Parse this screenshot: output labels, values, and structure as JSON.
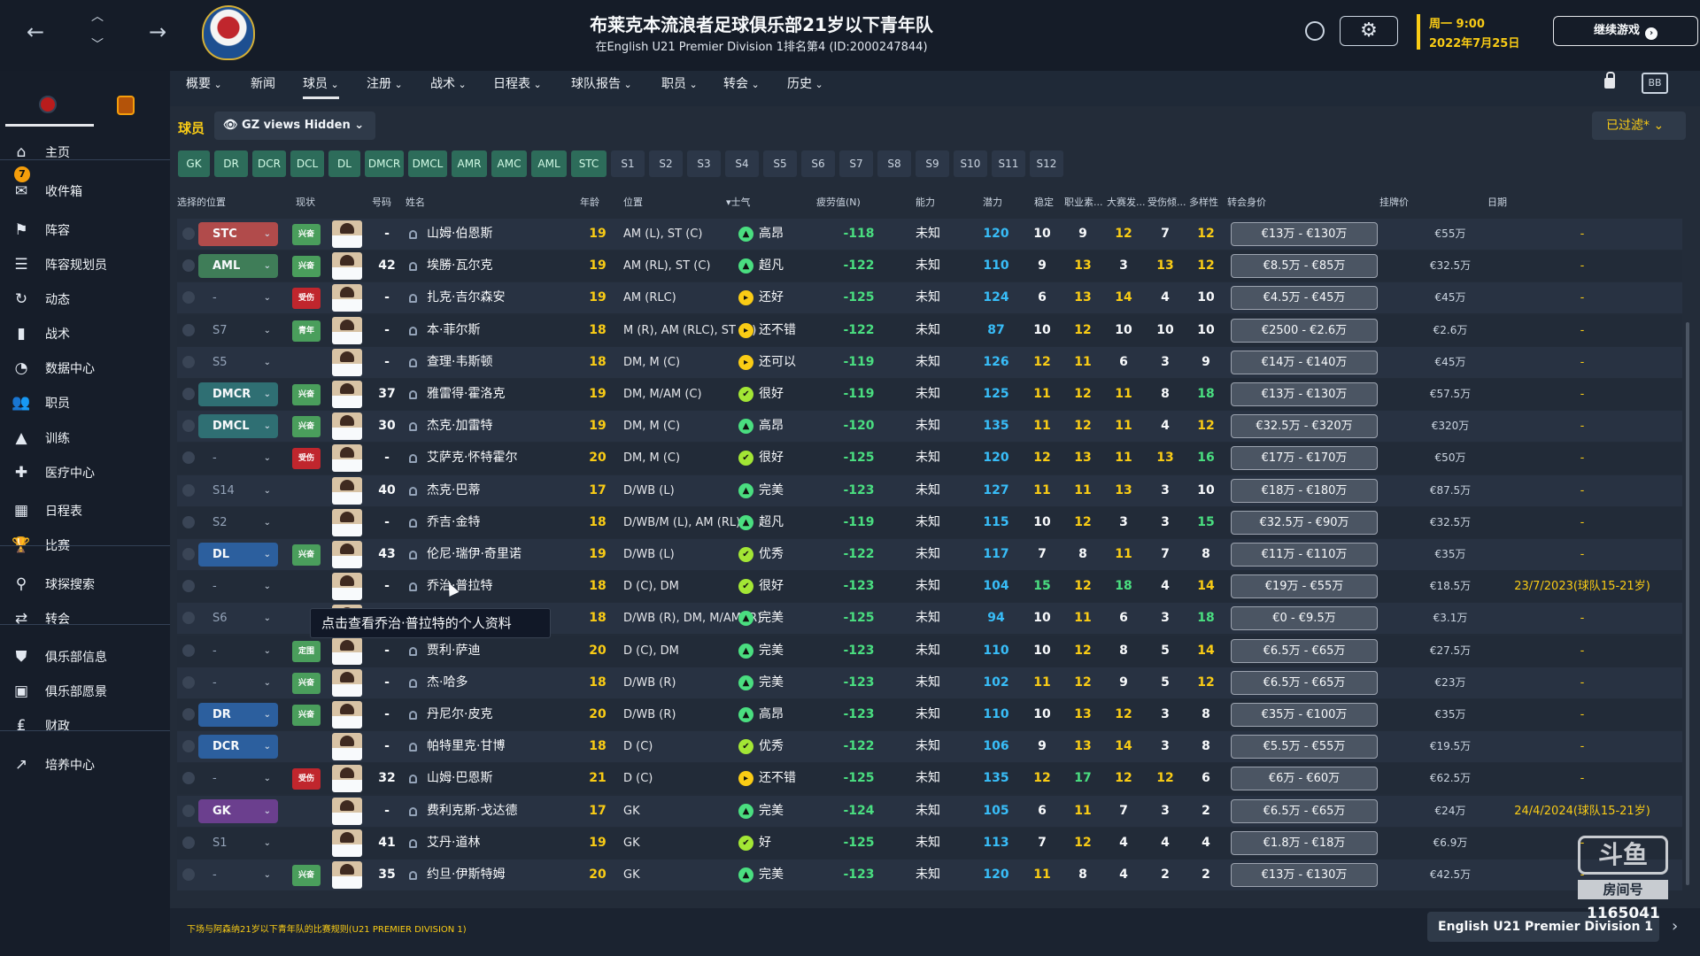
{
  "header": {
    "club_title": "布莱克本流浪者足球俱乐部21岁以下青年队",
    "club_subtitle": "在English U21 Premier Division 1排名第4 (ID:2000247844)",
    "date_day": "周一 9:00",
    "date_date": "2022年7月25日",
    "continue_label": "继续游戏",
    "nav_icons": {
      "back": "arrow-left-icon",
      "up": "chevron-up-icon",
      "down": "chevron-down-icon",
      "forward": "arrow-right-icon"
    },
    "settings_glyph": "⚙",
    "layout_glyph": "BB"
  },
  "nav": {
    "items": [
      {
        "label": "概要",
        "caret": true
      },
      {
        "label": "新闻",
        "caret": false
      },
      {
        "label": "球员",
        "caret": true,
        "active": true
      },
      {
        "label": "注册",
        "caret": true
      },
      {
        "label": "战术",
        "caret": true
      },
      {
        "label": "日程表",
        "caret": true
      },
      {
        "label": "球队报告",
        "caret": true
      },
      {
        "label": "职员",
        "caret": true
      },
      {
        "label": "转会",
        "caret": true
      },
      {
        "label": "历史",
        "caret": true
      }
    ]
  },
  "sidebar": {
    "inbox_count": "7",
    "items": [
      {
        "label": "主页",
        "icon": "⌂"
      },
      {
        "label": "收件箱",
        "icon": "✉"
      },
      {
        "label": "阵容",
        "icon": "⚑"
      },
      {
        "label": "阵容规划员",
        "icon": "☰"
      },
      {
        "label": "动态",
        "icon": "↻"
      },
      {
        "label": "战术",
        "icon": "▮"
      },
      {
        "label": "数据中心",
        "icon": "◔"
      },
      {
        "label": "职员",
        "icon": "👥"
      },
      {
        "label": "训练",
        "icon": "▲"
      },
      {
        "label": "医疗中心",
        "icon": "✚"
      },
      {
        "label": "日程表",
        "icon": "▦"
      },
      {
        "label": "比赛",
        "icon": "🏆"
      },
      {
        "label": "球探搜索",
        "icon": "⚲"
      },
      {
        "label": "转会",
        "icon": "⇄"
      },
      {
        "label": "俱乐部信息",
        "icon": "⛊"
      },
      {
        "label": "俱乐部愿景",
        "icon": "▣"
      },
      {
        "label": "财政",
        "icon": "₤"
      },
      {
        "label": "培养中心",
        "icon": "↗"
      }
    ]
  },
  "toolbar": {
    "players_label": "球员",
    "view_label": "GZ views Hidden",
    "filter_label": "已过滤*"
  },
  "position_filters": [
    "GK",
    "DR",
    "DCR",
    "DCL",
    "DL",
    "DMCR",
    "DMCL",
    "AMR",
    "AMC",
    "AML",
    "STC",
    "S1",
    "S2",
    "S3",
    "S4",
    "S5",
    "S6",
    "S7",
    "S8",
    "S9",
    "S10",
    "S11",
    "S12"
  ],
  "table": {
    "headers": {
      "selected_position": "选择的位置",
      "status": "现状",
      "number": "号码",
      "name": "姓名",
      "age": "年龄",
      "position": "位置",
      "morale": "士气",
      "fatigue": "疲劳值(N)",
      "ability": "能力",
      "potential": "潜力",
      "consistency": "稳定",
      "professionalism": "职业素...",
      "big_matches": "大赛发...",
      "injury_proneness": "受伤倾...",
      "versatility": "多样性",
      "transfer_value": "转会身价",
      "asking_price": "挂牌价",
      "expiry": "日期"
    },
    "rows": [
      {
        "sel": "STC",
        "sel_color": "#b14b4b",
        "status": "兴奋",
        "status_color": "#4a9e5c",
        "number": "-",
        "name": "山姆·伯恩斯",
        "age": "19",
        "position": "AM (L), ST (C)",
        "morale_icon": "up",
        "morale": "高昂",
        "fatigue": "-118",
        "ability": "未知",
        "potential": "120",
        "attrs": [
          "10",
          "9",
          "12",
          "7",
          "12"
        ],
        "value": "€13万 - €130万",
        "asking": "€55万",
        "expiry": "-"
      },
      {
        "sel": "AML",
        "sel_color": "#3f7d58",
        "status": "兴奋",
        "status_color": "#4a9e5c",
        "number": "42",
        "name": "埃勝·瓦尔克",
        "age": "19",
        "position": "AM (RL), ST (C)",
        "morale_icon": "up",
        "morale": "超凡",
        "fatigue": "-122",
        "ability": "未知",
        "potential": "110",
        "attrs": [
          "9",
          "13",
          "3",
          "13",
          "12"
        ],
        "value": "€8.5万 - €85万",
        "asking": "€32.5万",
        "expiry": "-"
      },
      {
        "sel": "-",
        "sel_color": "",
        "status": "受伤",
        "status_color": "#c0262d",
        "number": "-",
        "name": "扎克·吉尔森安",
        "age": "19",
        "position": "AM (RLC)",
        "morale_icon": "mid",
        "morale": "还好",
        "fatigue": "-125",
        "ability": "未知",
        "potential": "124",
        "attrs": [
          "6",
          "13",
          "14",
          "4",
          "10"
        ],
        "value": "€4.5万 - €45万",
        "asking": "€45万",
        "expiry": "-"
      },
      {
        "sel": "S7",
        "sel_color": "",
        "status": "青年",
        "status_color": "#4a9e5c",
        "number": "-",
        "name": "本·菲尔斯",
        "age": "18",
        "position": "M (R), AM (RLC), ST (C)",
        "morale_icon": "mid",
        "morale": "还不错",
        "fatigue": "-122",
        "ability": "未知",
        "potential": "87",
        "attrs": [
          "10",
          "12",
          "10",
          "10",
          "10"
        ],
        "value": "€2500 - €2.6万",
        "asking": "€2.6万",
        "expiry": "-"
      },
      {
        "sel": "S5",
        "sel_color": "",
        "status": "",
        "status_color": "",
        "number": "-",
        "name": "查理·韦斯顿",
        "age": "18",
        "position": "DM, M (C)",
        "morale_icon": "mid",
        "morale": "还可以",
        "fatigue": "-119",
        "ability": "未知",
        "potential": "126",
        "attrs": [
          "12",
          "11",
          "6",
          "3",
          "9"
        ],
        "value": "€14万 - €140万",
        "asking": "€45万",
        "expiry": "-"
      },
      {
        "sel": "DMCR",
        "sel_color": "#2f6f73",
        "status": "兴奋",
        "status_color": "#4a9e5c",
        "number": "37",
        "name": "雅雷得·霍洛克",
        "age": "19",
        "position": "DM, M/AM (C)",
        "morale_icon": "good",
        "morale": "很好",
        "fatigue": "-119",
        "ability": "未知",
        "potential": "125",
        "attrs": [
          "11",
          "12",
          "11",
          "8",
          "18"
        ],
        "value": "€13万 - €130万",
        "asking": "€57.5万",
        "expiry": "-"
      },
      {
        "sel": "DMCL",
        "sel_color": "#2f6f73",
        "status": "兴奋",
        "status_color": "#4a9e5c",
        "number": "30",
        "name": "杰克·加雷特",
        "age": "19",
        "position": "DM, M (C)",
        "morale_icon": "up",
        "morale": "高昂",
        "fatigue": "-120",
        "ability": "未知",
        "potential": "135",
        "attrs": [
          "11",
          "12",
          "11",
          "4",
          "12"
        ],
        "value": "€32.5万 - €320万",
        "asking": "€320万",
        "expiry": "-"
      },
      {
        "sel": "-",
        "sel_color": "",
        "status": "受伤",
        "status_color": "#c0262d",
        "number": "-",
        "name": "艾萨克·怀特霍尔",
        "age": "20",
        "position": "DM, M (C)",
        "morale_icon": "good",
        "morale": "很好",
        "fatigue": "-125",
        "ability": "未知",
        "potential": "120",
        "attrs": [
          "12",
          "13",
          "11",
          "13",
          "16"
        ],
        "value": "€17万 - €170万",
        "asking": "€50万",
        "expiry": "-"
      },
      {
        "sel": "S14",
        "sel_color": "",
        "status": "",
        "status_color": "",
        "number": "40",
        "name": "杰克·巴蒂",
        "age": "17",
        "position": "D/WB (L)",
        "morale_icon": "top",
        "morale": "完美",
        "fatigue": "-123",
        "ability": "未知",
        "potential": "127",
        "attrs": [
          "11",
          "11",
          "13",
          "3",
          "10"
        ],
        "value": "€18万 - €180万",
        "asking": "€87.5万",
        "expiry": "-"
      },
      {
        "sel": "S2",
        "sel_color": "",
        "status": "",
        "status_color": "",
        "number": "-",
        "name": "乔吉·金特",
        "age": "18",
        "position": "D/WB/M (L), AM (RL)",
        "morale_icon": "up",
        "morale": "超凡",
        "fatigue": "-119",
        "ability": "未知",
        "potential": "115",
        "attrs": [
          "10",
          "12",
          "3",
          "3",
          "15"
        ],
        "value": "€32.5万 - €90万",
        "asking": "€32.5万",
        "expiry": "-"
      },
      {
        "sel": "DL",
        "sel_color": "#2c5f9e",
        "status": "兴奋",
        "status_color": "#4a9e5c",
        "number": "43",
        "name": "伦尼·瑞伊·奇里诺",
        "age": "19",
        "position": "D/WB (L)",
        "morale_icon": "good",
        "morale": "优秀",
        "fatigue": "-122",
        "ability": "未知",
        "potential": "117",
        "attrs": [
          "7",
          "8",
          "11",
          "7",
          "8"
        ],
        "value": "€11万 - €110万",
        "asking": "€35万",
        "expiry": "-"
      },
      {
        "sel": "-",
        "sel_color": "",
        "status": "",
        "status_color": "",
        "number": "-",
        "name": "乔治·普拉特",
        "age": "18",
        "position": "D (C), DM",
        "morale_icon": "good",
        "morale": "很好",
        "fatigue": "-123",
        "ability": "未知",
        "potential": "104",
        "attrs": [
          "15",
          "12",
          "18",
          "4",
          "14"
        ],
        "value": "€19万 - €55万",
        "asking": "€18.5万",
        "expiry": "23/7/2023(球队15-21岁)"
      },
      {
        "sel": "S6",
        "sel_color": "",
        "status": "",
        "status_color": "",
        "number": "",
        "name": "",
        "age": "18",
        "position": "D/WB (R), DM, M/AM (R)",
        "morale_icon": "top",
        "morale": "完美",
        "fatigue": "-125",
        "ability": "未知",
        "potential": "94",
        "attrs": [
          "10",
          "11",
          "6",
          "3",
          "18"
        ],
        "value": "€0 - €9.5万",
        "asking": "€3.1万",
        "expiry": "-"
      },
      {
        "sel": "-",
        "sel_color": "",
        "status": "定围",
        "status_color": "#4a9e5c",
        "number": "-",
        "name": "贾利·萨迪",
        "age": "20",
        "position": "D (C), DM",
        "morale_icon": "top",
        "morale": "完美",
        "fatigue": "-123",
        "ability": "未知",
        "potential": "110",
        "attrs": [
          "10",
          "12",
          "8",
          "5",
          "14"
        ],
        "value": "€6.5万 - €65万",
        "asking": "€27.5万",
        "expiry": "-"
      },
      {
        "sel": "-",
        "sel_color": "",
        "status": "兴奋",
        "status_color": "#4a9e5c",
        "number": "-",
        "name": "杰·哈多",
        "age": "18",
        "position": "D/WB (R)",
        "morale_icon": "top",
        "morale": "完美",
        "fatigue": "-123",
        "ability": "未知",
        "potential": "102",
        "attrs": [
          "11",
          "12",
          "9",
          "5",
          "12"
        ],
        "value": "€6.5万 - €65万",
        "asking": "€23万",
        "expiry": "-"
      },
      {
        "sel": "DR",
        "sel_color": "#2c5f9e",
        "status": "兴奋",
        "status_color": "#4a9e5c",
        "number": "-",
        "name": "丹尼尔·皮克",
        "age": "20",
        "position": "D/WB (R)",
        "morale_icon": "up",
        "morale": "高昂",
        "fatigue": "-123",
        "ability": "未知",
        "potential": "110",
        "attrs": [
          "10",
          "13",
          "12",
          "3",
          "8"
        ],
        "value": "€35万 - €100万",
        "asking": "€35万",
        "expiry": "-"
      },
      {
        "sel": "DCR",
        "sel_color": "#2c5f9e",
        "status": "",
        "status_color": "",
        "number": "-",
        "name": "帕特里克·甘博",
        "age": "18",
        "position": "D (C)",
        "morale_icon": "good",
        "morale": "优秀",
        "fatigue": "-122",
        "ability": "未知",
        "potential": "106",
        "attrs": [
          "9",
          "13",
          "14",
          "3",
          "8"
        ],
        "value": "€5.5万 - €55万",
        "asking": "€19.5万",
        "expiry": "-"
      },
      {
        "sel": "-",
        "sel_color": "",
        "status": "受伤",
        "status_color": "#c0262d",
        "number": "32",
        "name": "山姆·巴恩斯",
        "age": "21",
        "position": "D (C)",
        "morale_icon": "mid",
        "morale": "还不错",
        "fatigue": "-125",
        "ability": "未知",
        "potential": "135",
        "attrs": [
          "12",
          "17",
          "12",
          "12",
          "6"
        ],
        "value": "€6万 - €60万",
        "asking": "€62.5万",
        "expiry": "-"
      },
      {
        "sel": "GK",
        "sel_color": "#6b3f8e",
        "status": "",
        "status_color": "",
        "number": "-",
        "name": "费利克斯·戈达德",
        "age": "17",
        "position": "GK",
        "morale_icon": "top",
        "morale": "完美",
        "fatigue": "-124",
        "ability": "未知",
        "potential": "105",
        "attrs": [
          "6",
          "11",
          "7",
          "3",
          "2"
        ],
        "value": "€6.5万 - €65万",
        "asking": "€24万",
        "expiry": "24/4/2024(球队15-21岁)"
      },
      {
        "sel": "S1",
        "sel_color": "",
        "status": "",
        "status_color": "",
        "number": "41",
        "name": "艾丹·道林",
        "age": "19",
        "position": "GK",
        "morale_icon": "good",
        "morale": "好",
        "fatigue": "-125",
        "ability": "未知",
        "potential": "113",
        "attrs": [
          "7",
          "12",
          "4",
          "4",
          "4"
        ],
        "value": "€1.8万 - €18万",
        "asking": "€6.9万",
        "expiry": "-"
      },
      {
        "sel": "-",
        "sel_color": "",
        "status": "兴奋",
        "status_color": "#4a9e5c",
        "number": "35",
        "name": "约旦·伊斯特姆",
        "age": "20",
        "position": "GK",
        "morale_icon": "top",
        "morale": "完美",
        "fatigue": "-123",
        "ability": "未知",
        "potential": "120",
        "attrs": [
          "11",
          "8",
          "4",
          "2",
          "2"
        ],
        "value": "€13万 - €130万",
        "asking": "€42.5万",
        "expiry": "-"
      }
    ]
  },
  "tooltip": "点击查看乔治·普拉特的个人资料",
  "footer": {
    "text": "下场与阿森纳21岁以下青年队的比赛规则(U21 PREMIER DIVISION 1)",
    "league_select": "English U21 Premier Division 1"
  },
  "watermark": {
    "logo": "斗鱼",
    "room": "房间号",
    "id": "1165041"
  },
  "colors": {
    "attr_high": "#4ade80",
    "attr_mid": "#facc15",
    "attr_low": "#f8fafc",
    "morale_up": "#4ade80",
    "morale_good": "#a3e635",
    "morale_mid": "#facc15",
    "morale_top": "#4ade80"
  }
}
